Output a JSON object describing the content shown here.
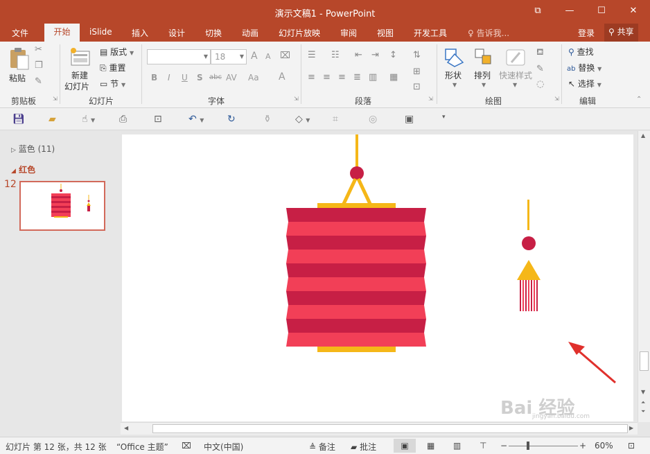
{
  "window": {
    "title": "演示文稿1 - PowerPoint",
    "ribbon_toggle": "⧉",
    "minimize": "—",
    "maximize": "☐",
    "close": "✕"
  },
  "tabs": {
    "file": "文件",
    "home": "开始",
    "islide": "iSlide",
    "insert": "插入",
    "design": "设计",
    "transitions": "切换",
    "animations": "动画",
    "slideshow": "幻灯片放映",
    "review": "审阅",
    "view": "视图",
    "developer": "开发工具",
    "tellme": "告诉我...",
    "login": "登录",
    "share": "共享"
  },
  "ribbon": {
    "paste": "粘贴",
    "clipboard": "剪贴板",
    "new_slide_line1": "新建",
    "new_slide_line2": "幻灯片",
    "layout": "版式",
    "reset": "重置",
    "section": "节",
    "slides_group": "幻灯片",
    "font_size": "18",
    "font_group": "字体",
    "paragraph_group": "段落",
    "shape": "形状",
    "arrange": "排列",
    "quick_styles": "快速样式",
    "drawing_group": "绘图",
    "find": "查找",
    "replace": "替换",
    "select": "选择",
    "editing_group": "编辑",
    "bold": "B",
    "italic": "I",
    "underline": "U",
    "shadow": "S",
    "strike": "abc",
    "spacing": "AV",
    "case": "Aa",
    "font_color": "A",
    "grow": "A",
    "shrink": "A"
  },
  "thumbs": {
    "section_blue": "蓝色 (11)",
    "section_red": "红色",
    "slide_number": "12"
  },
  "status": {
    "slide_info": "幻灯片 第 12 张，共 12 张",
    "theme": "“Office 主题”",
    "language": "中文(中国)",
    "notes": "备注",
    "comments": "批注",
    "zoom": "60%",
    "zoom_minus": "−",
    "zoom_plus": "+"
  },
  "watermark": {
    "text": "Bai 经验",
    "url": "jingyan.baidu.com"
  },
  "colors": {
    "accent": "#b7472a",
    "lantern_dark": "#c71f45",
    "lantern_light": "#f23f57",
    "gold": "#f5b718",
    "arrow": "#e0302c"
  }
}
